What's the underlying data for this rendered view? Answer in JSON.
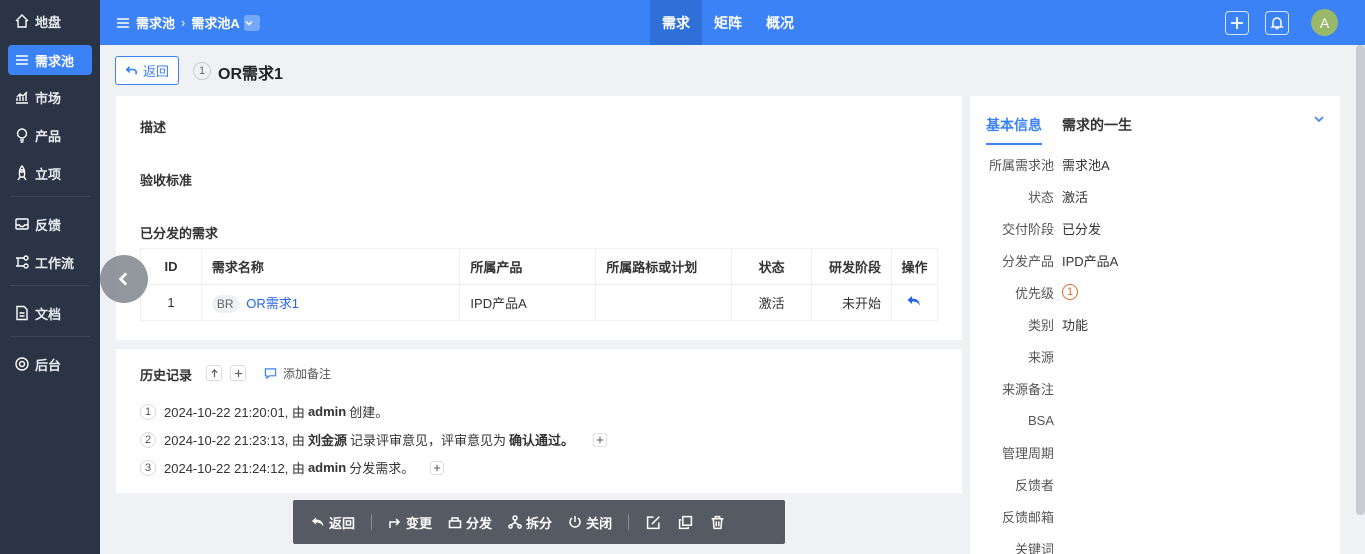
{
  "nav": {
    "items": [
      {
        "label": "地盘",
        "icon": "home-icon"
      },
      {
        "label": "需求池",
        "icon": "list-icon"
      },
      {
        "label": "市场",
        "icon": "chart-icon"
      },
      {
        "label": "产品",
        "icon": "bulb-icon"
      },
      {
        "label": "立项",
        "icon": "rocket-icon"
      },
      {
        "label": "反馈",
        "icon": "inbox-icon"
      },
      {
        "label": "工作流",
        "icon": "flow-icon"
      },
      {
        "label": "文档",
        "icon": "doc-icon"
      },
      {
        "label": "后台",
        "icon": "gear-icon"
      }
    ],
    "active_index": 1
  },
  "topbar": {
    "crumb_root": "需求池",
    "crumb_current": "需求池A",
    "tabs": [
      "需求",
      "矩阵",
      "概况"
    ],
    "active_tab": 0,
    "avatar_letter": "A"
  },
  "header": {
    "back_label": "返回",
    "index": "1",
    "title": "OR需求1"
  },
  "main": {
    "desc_title": "描述",
    "accept_title": "验收标准",
    "dist_title": "已分发的需求",
    "columns": [
      "ID",
      "需求名称",
      "所属产品",
      "所属路标或计划",
      "状态",
      "研发阶段",
      "操作"
    ],
    "rows": [
      {
        "id": "1",
        "tag": "BR",
        "name": "OR需求1",
        "product": "IPD产品A",
        "roadmap": "",
        "status": "激活",
        "stage": "未开始"
      }
    ]
  },
  "history": {
    "title": "历史记录",
    "add_note": "添加备注",
    "entries": [
      {
        "n": "1",
        "time": "2024-10-22 21:20:01, 由",
        "actor": "admin",
        "action": "创建。",
        "extra": "",
        "has_plus": false
      },
      {
        "n": "2",
        "time": "2024-10-22 21:23:13, 由",
        "actor": "刘金源",
        "action": "记录评审意见，评审意见为",
        "extra": "确认通过。",
        "has_plus": true
      },
      {
        "n": "3",
        "time": "2024-10-22 21:24:12, 由",
        "actor": "admin",
        "action": "分发需求。",
        "extra": "",
        "has_plus": true
      }
    ]
  },
  "side": {
    "tabs": [
      "基本信息",
      "需求的一生"
    ],
    "props": [
      {
        "label": "所属需求池",
        "value": "需求池A"
      },
      {
        "label": "状态",
        "value": "激活"
      },
      {
        "label": "交付阶段",
        "value": "已分发"
      },
      {
        "label": "分发产品",
        "value": "IPD产品A"
      },
      {
        "label": "优先级",
        "value": "1",
        "priority": true
      },
      {
        "label": "类别",
        "value": "功能"
      },
      {
        "label": "来源",
        "value": ""
      },
      {
        "label": "来源备注",
        "value": ""
      },
      {
        "label": "BSA",
        "value": ""
      },
      {
        "label": "管理周期",
        "value": ""
      },
      {
        "label": "反馈者",
        "value": ""
      },
      {
        "label": "反馈邮箱",
        "value": ""
      },
      {
        "label": "关键词",
        "value": ""
      }
    ]
  },
  "toolbar": {
    "back": "返回",
    "change": "变更",
    "distribute": "分发",
    "split": "拆分",
    "close": "关闭"
  },
  "colors": {
    "accent": "#3b82f6",
    "nav_bg": "#2b3444",
    "priority": "#e36b30"
  }
}
